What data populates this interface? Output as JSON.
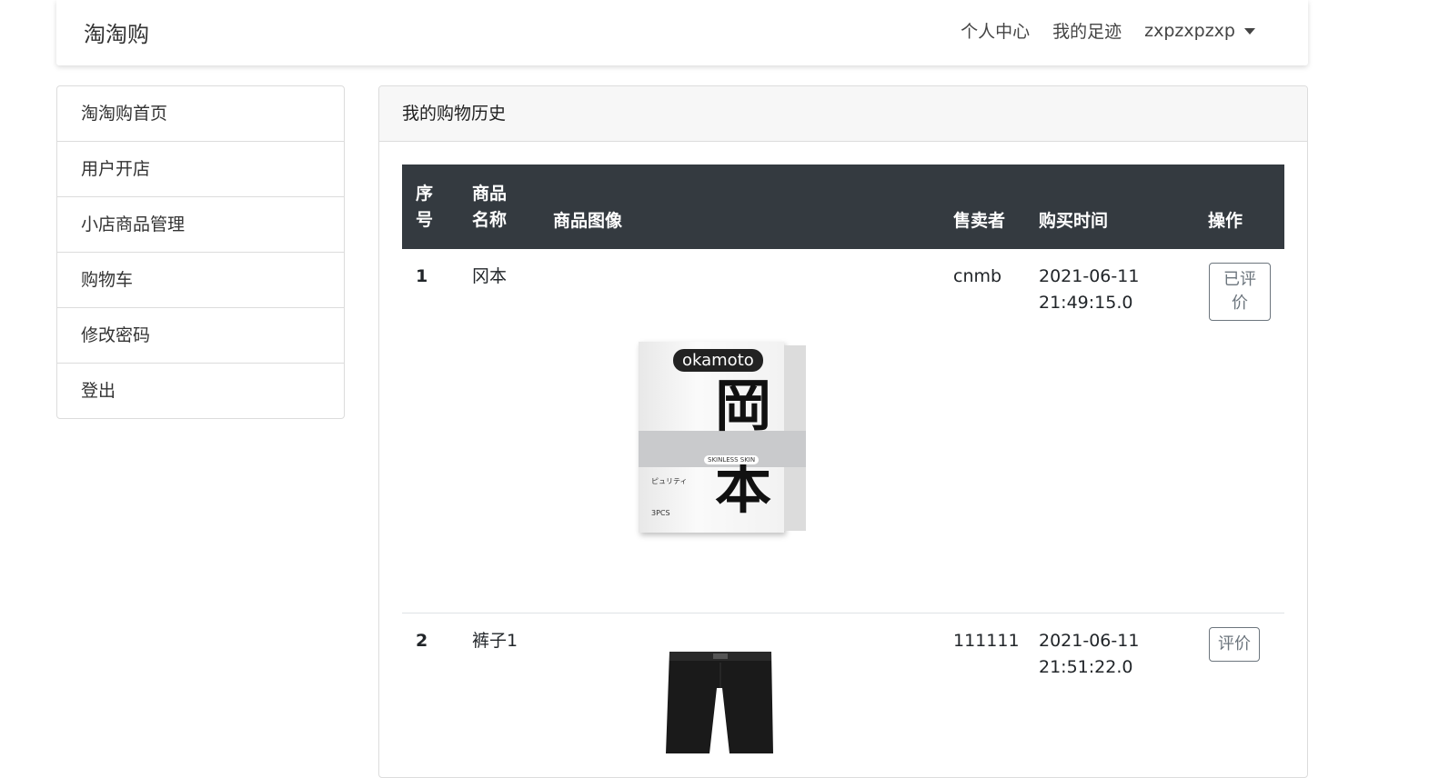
{
  "navbar": {
    "brand": "淘淘购",
    "links": [
      "个人中心",
      "我的足迹"
    ],
    "username": "zxpzxpzxp"
  },
  "sidebar": {
    "items": [
      "淘淘购首页",
      "用户开店",
      "小店商品管理",
      "购物车",
      "修改密码",
      "登出"
    ]
  },
  "card": {
    "title": "我的购物历史"
  },
  "table": {
    "headers": {
      "index": [
        "序",
        "号"
      ],
      "name": [
        "商品",
        "名称"
      ],
      "image": "商品图像",
      "seller": "售卖者",
      "time": "购买时间",
      "action": "操作"
    },
    "rows": [
      {
        "index": "1",
        "name": "冈本",
        "seller": "cnmb",
        "date": "2021-06-11",
        "time": "21:49:15.0",
        "action_lines": [
          "已评",
          "价"
        ],
        "image": {
          "logo": "okamoto",
          "chars": [
            "岡",
            "本"
          ],
          "band_text": "SKINLESS SKIN",
          "small_text": "ピュリティ",
          "pcs": "3PCS"
        }
      },
      {
        "index": "2",
        "name": "裤子1",
        "seller": "111111",
        "date": "2021-06-11",
        "time": "21:51:22.0",
        "action_lines": [
          "评价"
        ]
      }
    ]
  },
  "colors": {
    "table_header_bg": "#343a40",
    "button_border": "#6c757d"
  }
}
